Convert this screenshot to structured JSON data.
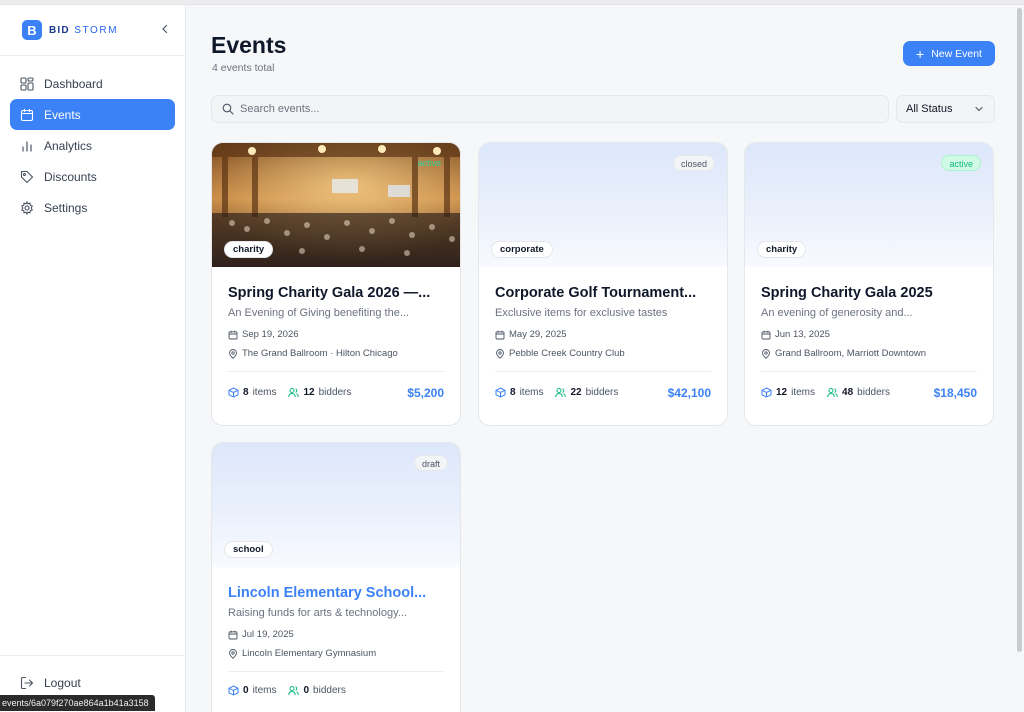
{
  "brand": {
    "logo_letter": "B",
    "name_strong": "BID",
    "name_rest": " STORM"
  },
  "nav": [
    {
      "label": "Dashboard",
      "icon": "grid-icon"
    },
    {
      "label": "Events",
      "icon": "calendar-icon",
      "active": true
    },
    {
      "label": "Analytics",
      "icon": "bar-chart-icon"
    },
    {
      "label": "Discounts",
      "icon": "tag-icon"
    },
    {
      "label": "Settings",
      "icon": "gear-icon"
    }
  ],
  "logout_label": "Logout",
  "status_url": "events/6a079f270ae864a1b41a3158",
  "header": {
    "title": "Events",
    "subtitle": "4 events total",
    "new_button": "New Event"
  },
  "search": {
    "placeholder": "Search events..."
  },
  "filter": {
    "selected": "All Status"
  },
  "events": [
    {
      "status": "active",
      "category": "charity",
      "title": "Spring Charity Gala 2026 —...",
      "description": "An Evening of Giving benefiting the...",
      "date": "Sep 19, 2026",
      "venue": "The Grand Ballroom · Hilton Chicago",
      "items": "8",
      "bidders": "12",
      "raised": "$5,200"
    },
    {
      "status": "closed",
      "category": "corporate",
      "title": "Corporate Golf Tournament...",
      "description": "Exclusive items for exclusive tastes",
      "date": "May 29, 2025",
      "venue": "Pebble Creek Country Club",
      "items": "8",
      "bidders": "22",
      "raised": "$42,100"
    },
    {
      "status": "active",
      "category": "charity",
      "title": "Spring Charity Gala 2025",
      "description": "An evening of generosity and...",
      "date": "Jun 13, 2025",
      "venue": "Grand Ballroom, Marriott Downtown",
      "items": "12",
      "bidders": "48",
      "raised": "$18,450"
    },
    {
      "status": "draft",
      "category": "school",
      "title": "Lincoln Elementary School...",
      "description": "Raising funds for arts & technology...",
      "date": "Jul 19, 2025",
      "venue": "Lincoln Elementary Gymnasium",
      "items": "0",
      "bidders": "0",
      "raised": ""
    }
  ],
  "labels": {
    "items": "items",
    "bidders": "bidders"
  },
  "colors": {
    "accent": "#3b82f6",
    "active_green": "#10b981"
  }
}
